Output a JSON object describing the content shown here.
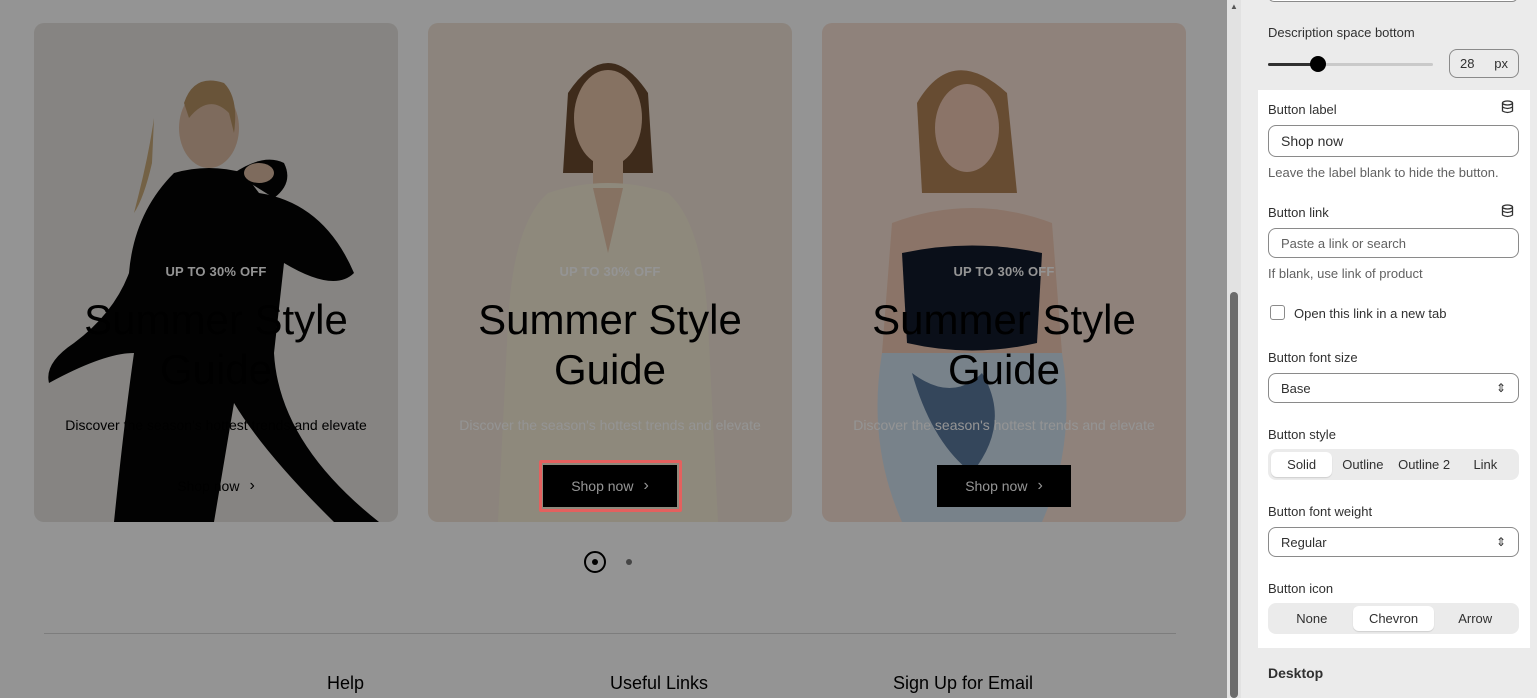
{
  "preview": {
    "cards": [
      {
        "eyebrow": "UP TO 30% OFF",
        "headline": "Summer Style Guide",
        "description": "Discover the season's hottest trends and elevate",
        "button": "Shop now",
        "bg": "#e7e4e0"
      },
      {
        "eyebrow": "UP TO 30% OFF",
        "headline": "Summer Style Guide",
        "description": "Discover the season's hottest trends and elevate",
        "button": "Shop now",
        "bg": "#f1e4d8"
      },
      {
        "eyebrow": "UP TO 30% OFF",
        "headline": "Summer Style Guide",
        "description": "Discover the season's hottest trends and elevate",
        "button": "Shop now",
        "bg": "#f7e0d4"
      }
    ],
    "footer": {
      "help": "Help",
      "useful_links": "Useful Links",
      "sign_up": "Sign Up for Email"
    }
  },
  "panel": {
    "desc_space_bottom": {
      "label": "Description space bottom",
      "value": "28",
      "unit": "px"
    },
    "button_label": {
      "label": "Button label",
      "value": "Shop now",
      "help": "Leave the label blank to hide the button."
    },
    "button_link": {
      "label": "Button link",
      "placeholder": "Paste a link or search",
      "help": "If blank, use link of product"
    },
    "new_tab": {
      "label": "Open this link in a new tab"
    },
    "font_size": {
      "label": "Button font size",
      "value": "Base"
    },
    "style": {
      "label": "Button style",
      "options": [
        "Solid",
        "Outline",
        "Outline 2",
        "Link"
      ],
      "selected": "Solid"
    },
    "font_weight": {
      "label": "Button font weight",
      "value": "Regular"
    },
    "icon": {
      "label": "Button icon",
      "options": [
        "None",
        "Chevron",
        "Arrow"
      ],
      "selected": "Chevron"
    },
    "section_desktop": "Desktop"
  },
  "colors": {
    "highlight": "#e4605e",
    "button_bg": "#000000"
  },
  "icons": [
    "database-icon",
    "chevron-right-icon",
    "select-chevron-icon"
  ]
}
